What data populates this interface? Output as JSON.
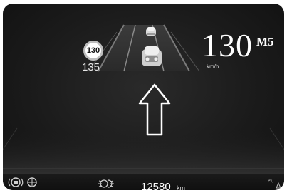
{
  "speed_limit_sign": "130",
  "detected_speed": "135",
  "current_speed": {
    "value": "130",
    "unit": "km/h"
  },
  "gear": "M5",
  "odometer": {
    "value": "12580",
    "unit": "km"
  },
  "icons": [
    "parking-brake-icon",
    "park-assist-icon",
    "light-indicator-icon",
    "park-distance-icon",
    "direction-arrow-icon",
    "lead-car-icon",
    "own-car-icon"
  ]
}
